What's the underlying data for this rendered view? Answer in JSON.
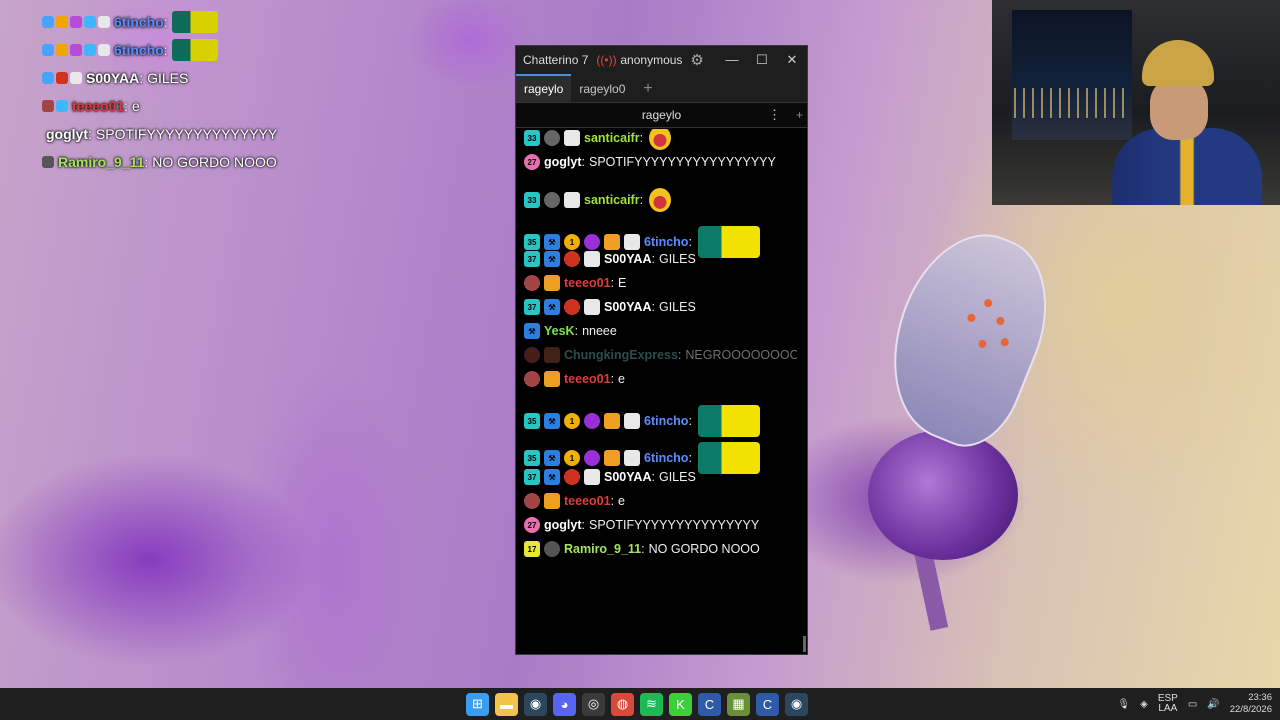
{
  "overlay_chat": [
    {
      "badges": [
        "#4aa3ff",
        "#f0a500",
        "#b44dd8",
        "#3db7ff",
        "#e8e8e8"
      ],
      "name": "6tincho",
      "name_color": "#5b8dff",
      "sep": ":",
      "text": "",
      "emote": true
    },
    {
      "badges": [
        "#4aa3ff",
        "#f0a500",
        "#b44dd8",
        "#3db7ff",
        "#e8e8e8"
      ],
      "name": "6tincho",
      "name_color": "#5b8dff",
      "sep": ":",
      "text": "",
      "emote": true
    },
    {
      "badges": [
        "#4aa3ff",
        "#cf3320",
        "#e8e8e8"
      ],
      "name": "S00YAA",
      "name_color": "#ffffff",
      "sep": ":",
      "text": "GILES",
      "emote": false
    },
    {
      "badges": [
        "#a34545",
        "#3db7ff"
      ],
      "name": "teeeo01",
      "name_color": "#e03c3c",
      "sep": ":",
      "text": "e",
      "emote": false
    },
    {
      "badges": [],
      "name": "goglyt",
      "name_color": "#ffffff",
      "sep": ":",
      "text": "SPOTIFYYYYYYYYYYYYYY",
      "emote": false
    },
    {
      "badges": [
        "#555555"
      ],
      "name": "Ramiro_9_11",
      "name_color": "#a4e45c",
      "sep": ":",
      "text": "NO GORDO NOOO",
      "emote": false
    }
  ],
  "window": {
    "app_title": "Chatterino 7",
    "stream_icon": "broadcast-icon",
    "user": "anonymous",
    "settings_icon": "⚙",
    "minimize": "—",
    "maximize": "☐",
    "close": "✕",
    "tabs": [
      {
        "label": "rageylo",
        "active": true
      },
      {
        "label": "rageylo0",
        "active": false
      }
    ],
    "tab_add": "+",
    "split_title": "rageylo",
    "split_menu": "⋮",
    "split_add": "+"
  },
  "messages": [
    {
      "badges": [
        {
          "t": "37",
          "c": "#29c4c4"
        },
        {
          "t": "⚒",
          "c": "#2c7fe0"
        },
        {
          "t": "",
          "c": "#cf3320",
          "r": true
        },
        {
          "t": "",
          "c": "#e8e8e8"
        }
      ],
      "name": "S00YAA",
      "color": "#ffffff",
      "sep": ":",
      "text": "GILES",
      "emote": ""
    },
    {
      "badges": [
        {
          "t": "33",
          "c": "#29c4c4"
        },
        {
          "t": "",
          "c": "#666666",
          "r": true
        },
        {
          "t": "",
          "c": "#e8e8e8"
        }
      ],
      "name": "santicaifr",
      "color": "#9fe23a",
      "sep": ":",
      "text": "",
      "emote": "face"
    },
    {
      "badges": [
        {
          "t": "33",
          "c": "#29c4c4"
        },
        {
          "t": "",
          "c": "#666666",
          "r": true
        },
        {
          "t": "",
          "c": "#e8e8e8"
        }
      ],
      "name": "santicaifr",
      "color": "#9fe23a",
      "sep": ":",
      "text": "",
      "emote": "face"
    },
    {
      "badges": [
        {
          "t": "27",
          "c": "#e86fb1",
          "r": true
        }
      ],
      "name": "goglyt",
      "color": "#ffffff",
      "sep": ":",
      "text": "SPOTIFYYYYYYYYYYYYYYYYY",
      "emote": ""
    },
    {
      "badges": [
        {
          "t": "33",
          "c": "#29c4c4"
        },
        {
          "t": "",
          "c": "#666666",
          "r": true
        },
        {
          "t": "",
          "c": "#e8e8e8"
        }
      ],
      "name": "santicaifr",
      "color": "#9fe23a",
      "sep": ":",
      "text": "",
      "emote": "face"
    },
    {
      "badges": [
        {
          "t": "35",
          "c": "#29c4c4"
        },
        {
          "t": "⚒",
          "c": "#2c7fe0"
        },
        {
          "t": "1",
          "c": "#f0b000",
          "r": true
        },
        {
          "t": "",
          "c": "#9a2fd8",
          "r": true
        },
        {
          "t": "",
          "c": "#f0a020"
        },
        {
          "t": "",
          "c": "#e8e8e8"
        }
      ],
      "name": "6tincho",
      "color": "#5b8dff",
      "sep": ":",
      "text": "",
      "emote": "emote"
    },
    {
      "badges": [
        {
          "t": "37",
          "c": "#29c4c4"
        },
        {
          "t": "⚒",
          "c": "#2c7fe0"
        },
        {
          "t": "",
          "c": "#cf3320",
          "r": true
        },
        {
          "t": "",
          "c": "#e8e8e8"
        }
      ],
      "name": "S00YAA",
      "color": "#ffffff",
      "sep": ":",
      "text": "GILES",
      "emote": ""
    },
    {
      "badges": [
        {
          "t": "",
          "c": "#a34545",
          "r": true
        },
        {
          "t": "",
          "c": "#f0a020"
        }
      ],
      "name": "teeeo01",
      "color": "#e03c3c",
      "sep": ":",
      "text": "E",
      "emote": ""
    },
    {
      "badges": [
        {
          "t": "37",
          "c": "#29c4c4"
        },
        {
          "t": "⚒",
          "c": "#2c7fe0"
        },
        {
          "t": "",
          "c": "#cf3320",
          "r": true
        },
        {
          "t": "",
          "c": "#e8e8e8"
        }
      ],
      "name": "S00YAA",
      "color": "#ffffff",
      "sep": ":",
      "text": "GILES",
      "emote": ""
    },
    {
      "badges": [
        {
          "t": "⚒",
          "c": "#2c7fe0"
        }
      ],
      "name": "YesK",
      "color": "#7fe24a",
      "sep": ":",
      "text": "nneee",
      "emote": ""
    },
    {
      "badges": [
        {
          "t": "",
          "c": "#7a2f2f",
          "r": true
        },
        {
          "t": "",
          "c": "#6b3a2a"
        }
      ],
      "name": "ChungkingExpress",
      "color": "#4a8080",
      "sep": ":",
      "text": "NEGROOOOOOOO",
      "emote": "",
      "dim": true
    },
    {
      "badges": [
        {
          "t": "",
          "c": "#a34545",
          "r": true
        },
        {
          "t": "",
          "c": "#f0a020"
        }
      ],
      "name": "teeeo01",
      "color": "#e03c3c",
      "sep": ":",
      "text": "e",
      "emote": ""
    },
    {
      "badges": [
        {
          "t": "35",
          "c": "#29c4c4"
        },
        {
          "t": "⚒",
          "c": "#2c7fe0"
        },
        {
          "t": "1",
          "c": "#f0b000",
          "r": true
        },
        {
          "t": "",
          "c": "#9a2fd8",
          "r": true
        },
        {
          "t": "",
          "c": "#f0a020"
        },
        {
          "t": "",
          "c": "#e8e8e8"
        }
      ],
      "name": "6tincho",
      "color": "#5b8dff",
      "sep": ":",
      "text": "",
      "emote": "emote"
    },
    {
      "badges": [
        {
          "t": "35",
          "c": "#29c4c4"
        },
        {
          "t": "⚒",
          "c": "#2c7fe0"
        },
        {
          "t": "1",
          "c": "#f0b000",
          "r": true
        },
        {
          "t": "",
          "c": "#9a2fd8",
          "r": true
        },
        {
          "t": "",
          "c": "#f0a020"
        },
        {
          "t": "",
          "c": "#e8e8e8"
        }
      ],
      "name": "6tincho",
      "color": "#5b8dff",
      "sep": ":",
      "text": "",
      "emote": "emote"
    },
    {
      "badges": [
        {
          "t": "37",
          "c": "#29c4c4"
        },
        {
          "t": "⚒",
          "c": "#2c7fe0"
        },
        {
          "t": "",
          "c": "#cf3320",
          "r": true
        },
        {
          "t": "",
          "c": "#e8e8e8"
        }
      ],
      "name": "S00YAA",
      "color": "#ffffff",
      "sep": ":",
      "text": "GILES",
      "emote": ""
    },
    {
      "badges": [
        {
          "t": "",
          "c": "#a34545",
          "r": true
        },
        {
          "t": "",
          "c": "#f0a020"
        }
      ],
      "name": "teeeo01",
      "color": "#e03c3c",
      "sep": ":",
      "text": "e",
      "emote": ""
    },
    {
      "badges": [
        {
          "t": "27",
          "c": "#e86fb1",
          "r": true
        }
      ],
      "name": "goglyt",
      "color": "#ffffff",
      "sep": ":",
      "text": "SPOTIFYYYYYYYYYYYYYYY",
      "emote": ""
    },
    {
      "badges": [
        {
          "t": "17",
          "c": "#e8e83a"
        },
        {
          "t": "",
          "c": "#555555",
          "r": true
        }
      ],
      "name": "Ramiro_9_11",
      "color": "#a4e45c",
      "sep": ":",
      "text": "NO GORDO NOOO",
      "emote": ""
    }
  ],
  "taskbar": {
    "apps": [
      {
        "name": "windows-start-icon",
        "glyph": "⊞",
        "color": "#3b9cf0"
      },
      {
        "name": "file-explorer-icon",
        "glyph": "▬",
        "color": "#f2c44a"
      },
      {
        "name": "steam-icon",
        "glyph": "◉",
        "color": "#2a475e"
      },
      {
        "name": "discord-icon",
        "glyph": "◕",
        "color": "#5865f2"
      },
      {
        "name": "obs-icon",
        "glyph": "◎",
        "color": "#3a3a3a"
      },
      {
        "name": "chrome-icon",
        "glyph": "◍",
        "color": "#d94a3a"
      },
      {
        "name": "spotify-icon",
        "glyph": "≋",
        "color": "#1db954"
      },
      {
        "name": "kick-icon",
        "glyph": "K",
        "color": "#3ccf3c"
      },
      {
        "name": "chatterino-icon",
        "glyph": "C",
        "color": "#2f5aa8"
      },
      {
        "name": "minecraft-icon",
        "glyph": "▦",
        "color": "#6a8f3a"
      },
      {
        "name": "chatterino-icon-2",
        "glyph": "C",
        "color": "#2f5aa8"
      },
      {
        "name": "steam-icon-2",
        "glyph": "◉",
        "color": "#2a475e"
      }
    ],
    "tray": {
      "lang_top": "ESP",
      "lang_bottom": "LAA",
      "time": "23:36",
      "date": "22/8/2026"
    }
  }
}
